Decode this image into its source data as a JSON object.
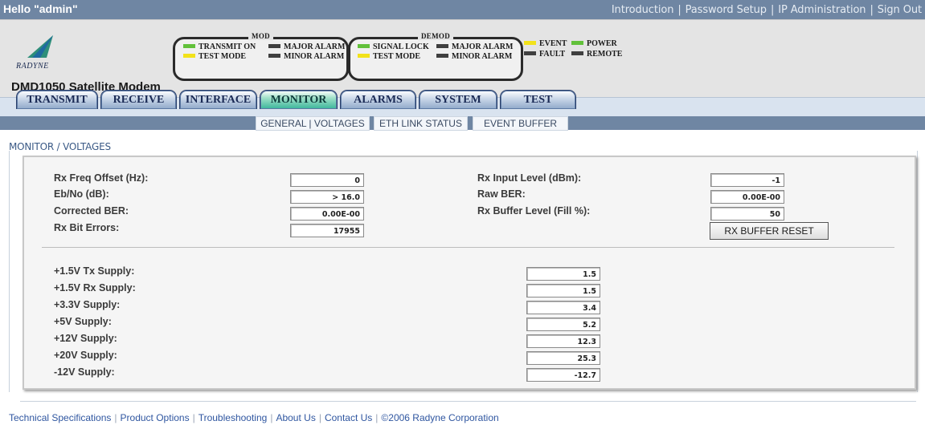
{
  "topbar": {
    "greeting": "Hello \"admin\"",
    "links": [
      "Introduction",
      "Password Setup",
      "IP Administration",
      "Sign Out"
    ],
    "separator": "|"
  },
  "header": {
    "logo_text": "RADYNE",
    "model": "DMD1050 Satellite Modem",
    "mod_box": {
      "title": "MOD",
      "leds": [
        {
          "label": "TRANSMIT ON",
          "color": "green"
        },
        {
          "label": "MAJOR ALARM",
          "color": "dark"
        },
        {
          "label": "TEST MODE",
          "color": "yellow"
        },
        {
          "label": "MINOR ALARM",
          "color": "dark"
        }
      ]
    },
    "demod_box": {
      "title": "DEMOD",
      "leds": [
        {
          "label": "SIGNAL LOCK",
          "color": "green"
        },
        {
          "label": "MAJOR ALARM",
          "color": "dark"
        },
        {
          "label": "TEST MODE",
          "color": "yellow"
        },
        {
          "label": "MINOR ALARM",
          "color": "dark"
        }
      ]
    },
    "status_leds": [
      {
        "label": "EVENT",
        "color": "yellow"
      },
      {
        "label": "POWER",
        "color": "green"
      },
      {
        "label": "FAULT",
        "color": "dark"
      },
      {
        "label": "REMOTE",
        "color": "dark"
      }
    ]
  },
  "tabs": [
    {
      "label": "TRANSMIT",
      "active": false
    },
    {
      "label": "RECEIVE",
      "active": false
    },
    {
      "label": "INTERFACE",
      "active": false
    },
    {
      "label": "MONITOR",
      "active": true
    },
    {
      "label": "ALARMS",
      "active": false
    },
    {
      "label": "SYSTEM",
      "active": false
    },
    {
      "label": "TEST",
      "active": false
    }
  ],
  "subtabs": [
    "GENERAL | VOLTAGES",
    "ETH LINK STATUS",
    "EVENT BUFFER"
  ],
  "breadcrumb": "MONITOR / VOLTAGES",
  "receiver": {
    "left": [
      {
        "label": "Rx Freq Offset (Hz):",
        "value": "0"
      },
      {
        "label": "Eb/No (dB):",
        "value": "> 16.0"
      },
      {
        "label": "Corrected BER:",
        "value": "0.00E-00"
      },
      {
        "label": "Rx Bit Errors:",
        "value": "17955"
      }
    ],
    "right": [
      {
        "label": "Rx Input Level (dBm):",
        "value": "-1"
      },
      {
        "label": "Raw BER:",
        "value": "0.00E-00"
      },
      {
        "label": "Rx Buffer Level (Fill %):",
        "value": "50"
      }
    ],
    "reset_button": "RX BUFFER RESET"
  },
  "voltages": [
    {
      "label": "+1.5V Tx Supply:",
      "value": "1.5"
    },
    {
      "label": "+1.5V Rx Supply:",
      "value": "1.5"
    },
    {
      "label": "+3.3V Supply:",
      "value": "3.4"
    },
    {
      "label": "+5V Supply:",
      "value": "5.2"
    },
    {
      "label": "+12V Supply:",
      "value": "12.3"
    },
    {
      "label": "+20V Supply:",
      "value": "25.3"
    },
    {
      "label": "-12V Supply:",
      "value": "-12.7"
    }
  ],
  "footer": {
    "links": [
      "Technical Specifications",
      "Product Options",
      "Troubleshooting",
      "About Us",
      "Contact Us"
    ],
    "copyright": "©2006 Radyne Corporation"
  },
  "colors": {
    "topbar": "#6f86a3",
    "header_bg": "#e4e4e4",
    "tab_active": "#3ab59a",
    "led_green": "#62c13a",
    "led_yellow": "#f2e21a",
    "led_dark": "#3f3f3f",
    "link_blue": "#2f56a0"
  }
}
